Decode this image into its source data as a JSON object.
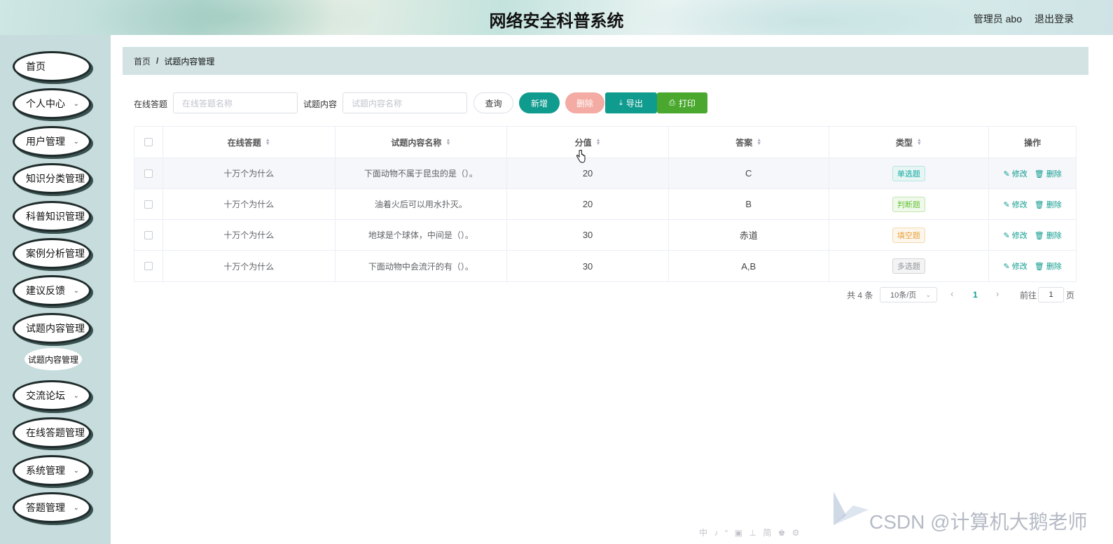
{
  "header": {
    "title": "网络安全科普系统",
    "user": "管理员 abo",
    "logout": "退出登录"
  },
  "sidebar": {
    "items": [
      {
        "label": "首页",
        "expandable": false
      },
      {
        "label": "个人中心",
        "expandable": true
      },
      {
        "label": "用户管理",
        "expandable": true
      },
      {
        "label": "知识分类管理",
        "expandable": false
      },
      {
        "label": "科普知识管理",
        "expandable": false
      },
      {
        "label": "案例分析管理",
        "expandable": false
      },
      {
        "label": "建议反馈",
        "expandable": true
      },
      {
        "label": "试题内容管理",
        "expandable": false
      },
      {
        "label": "交流论坛",
        "expandable": true
      },
      {
        "label": "在线答题管理",
        "expandable": false
      },
      {
        "label": "系统管理",
        "expandable": true
      },
      {
        "label": "答题管理",
        "expandable": true
      }
    ],
    "sub_item": "试题内容管理"
  },
  "breadcrumb": {
    "home": "首页",
    "separator": "/",
    "current": "试题内容管理"
  },
  "search": {
    "label1": "在线答题",
    "placeholder1": "在线答题名称",
    "label2": "试题内容",
    "placeholder2": "试题内容名称",
    "query": "查询",
    "add": "新增",
    "delete": "删除",
    "export": "导出",
    "print": "打印"
  },
  "table": {
    "headers": [
      "在线答题",
      "试题内容名称",
      "分值",
      "答案",
      "类型",
      "操作"
    ],
    "rows": [
      {
        "quiz": "十万个为什么",
        "content": "下面动物不属于昆虫的是（）。",
        "score": "20",
        "answer": "C",
        "type": "单选题",
        "type_color": "#13a89e",
        "type_bg": "#e7f6f5",
        "type_border": "#b8e5e1"
      },
      {
        "quiz": "十万个为什么",
        "content": "油着火后可以用水扑灭。",
        "score": "20",
        "answer": "B",
        "type": "判断题",
        "type_color": "#67c23a",
        "type_bg": "#f0f9eb",
        "type_border": "#c2e7b0"
      },
      {
        "quiz": "十万个为什么",
        "content": "地球是个球体，中间是（）。",
        "score": "30",
        "answer": "赤道",
        "type": "填空题",
        "type_color": "#e6a23c",
        "type_bg": "#fdf6ec",
        "type_border": "#f5dab1"
      },
      {
        "quiz": "十万个为什么",
        "content": "下面动物中会流汗的有（）。",
        "score": "30",
        "answer": "A,B",
        "type": "多选题",
        "type_color": "#909399",
        "type_bg": "#f4f4f5",
        "type_border": "#d3d4d6"
      }
    ],
    "edit": "修改",
    "remove": "删除"
  },
  "pagination": {
    "total": "共 4 条",
    "page_size": "10条/页",
    "current_page": "1",
    "goto_label": "前往",
    "goto_value": "1",
    "page_unit": "页"
  },
  "watermark": "CSDN @计算机大鹅老师",
  "ime_bar": "中 ♪ ° ▣ ⊥ 简 ♚ ⚙"
}
